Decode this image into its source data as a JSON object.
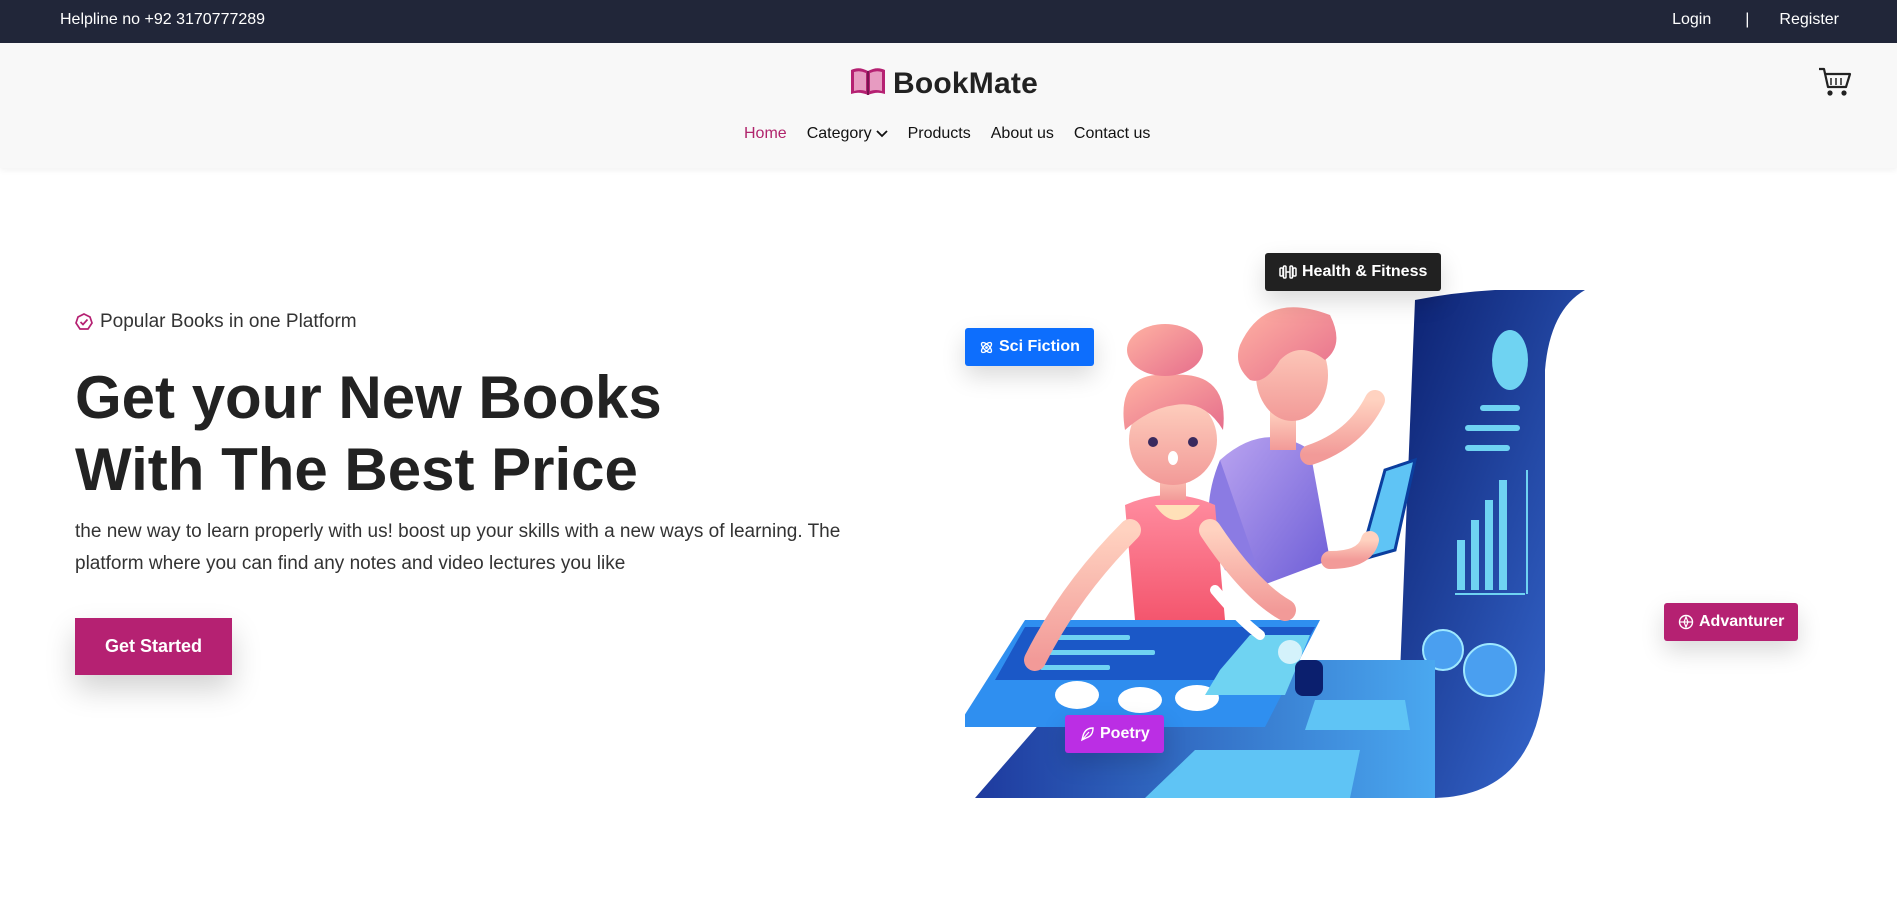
{
  "topbar": {
    "helpline": "Helpline no +92 3170777289",
    "login": "Login",
    "separator": "|",
    "register": "Register"
  },
  "header": {
    "logo_text": "BookMate",
    "logo_icon": "open-book-icon",
    "cart_icon": "cart-icon",
    "nav": [
      {
        "label": "Home",
        "active": true
      },
      {
        "label": "Category",
        "has_dropdown": true
      },
      {
        "label": "Products"
      },
      {
        "label": "About us"
      },
      {
        "label": "Contact us"
      }
    ]
  },
  "hero": {
    "badge": "Popular Books in one Platform",
    "title_line1": "Get your New Books",
    "title_line2": "With The Best Price",
    "description": "the new way to learn properly with us! boost up your skills with a new ways of learning. The platform where you can find any notes and video lectures you like",
    "cta": "Get Started"
  },
  "tags": {
    "health": "Health & Fitness",
    "sci": "Sci Fiction",
    "adventurer": "Advanturer",
    "poetry": "Poetry"
  },
  "colors": {
    "brand": "#b52172",
    "topbar_bg": "#212639",
    "header_bg": "#f8f8f8",
    "sci_tag": "#0d6efd",
    "health_tag": "#212121",
    "poetry_tag": "#bb2ee4"
  }
}
